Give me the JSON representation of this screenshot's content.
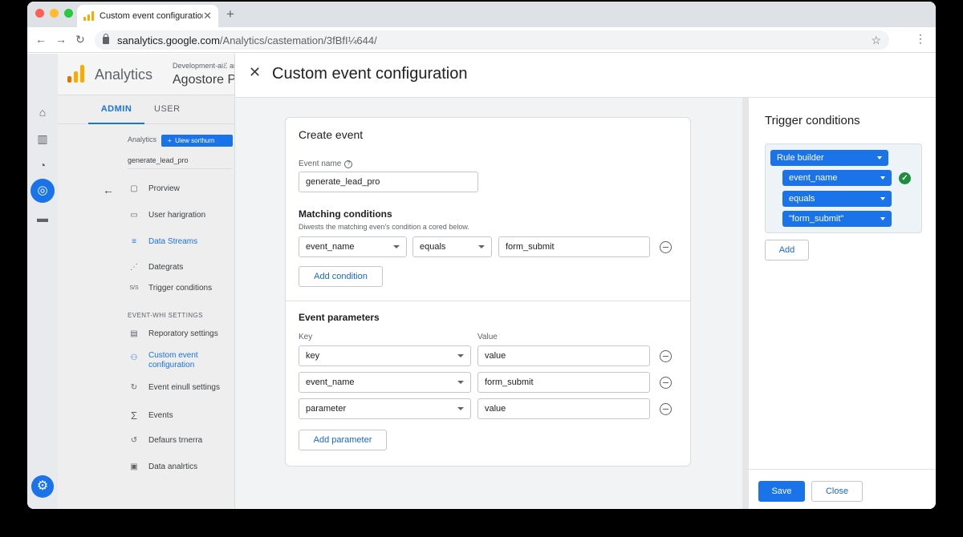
{
  "browser": {
    "tab_title": "Custom event configuration",
    "new_tab": "+",
    "url_host": "sanalytics.google.com",
    "url_path": "/Analytics/castemation/3fBfI¼644/"
  },
  "sidebar": {
    "brand": "Analytics",
    "account_line": "Development-aiℰ analytics",
    "property_name": "Agostore Pautin",
    "tab_admin": "ADMIN",
    "tab_user": "USER",
    "analytics_label": "Analytics",
    "add_view_label": "Uiew sorthurn",
    "property_id": "generate_lead_pro",
    "section_label": "EVENT-WHI SETTINGS",
    "items": [
      {
        "label": "Prorview",
        "icon": "▢"
      },
      {
        "label": "User harigration",
        "icon": "▭"
      },
      {
        "label": "Data Streams",
        "icon": "≡"
      },
      {
        "label": "Dategrats",
        "icon": "⋰"
      },
      {
        "label": "Trigger conditions",
        "icon": "S/S"
      },
      {
        "label": "Reporatory settings",
        "icon": "▤"
      },
      {
        "label": "Custom event configuration",
        "icon": "⚇"
      },
      {
        "label": "Event einull settings",
        "icon": "↻"
      },
      {
        "label": "Events",
        "icon": "Σ"
      },
      {
        "label": "Defaurs trnerra",
        "icon": "↺"
      },
      {
        "label": "Data analrtics",
        "icon": "▣"
      }
    ]
  },
  "dialog": {
    "title": "Custom event configuration",
    "card_title": "Create event",
    "event_name_label": "Event name",
    "event_name_value": "generate_lead_pro",
    "matching_title": "Matching conditions",
    "matching_desc": "Diwests the matching even's condition a cored below.",
    "condition": {
      "param": "event_name",
      "operator": "equals",
      "value": "form_submit"
    },
    "add_condition_label": "Add condition",
    "params_title": "Event parameters",
    "key_label": "Key",
    "value_label": "Value",
    "params": [
      {
        "key": "key",
        "value": "value"
      },
      {
        "key": "event_name",
        "value": "form_submit"
      },
      {
        "key": "parameter",
        "value": "value"
      }
    ],
    "add_parameter_label": "Add parameter"
  },
  "trigger": {
    "title": "Trigger conditions",
    "rule_builder": "Rule builder",
    "chips": [
      "event_name",
      "equals",
      "\"form_submit\""
    ],
    "add_label": "Add",
    "save_label": "Save",
    "close_label": "Close"
  },
  "colors": {
    "accent": "#1a73e8",
    "success": "#1e8e3e",
    "ga_orange": "#f9ab00"
  }
}
